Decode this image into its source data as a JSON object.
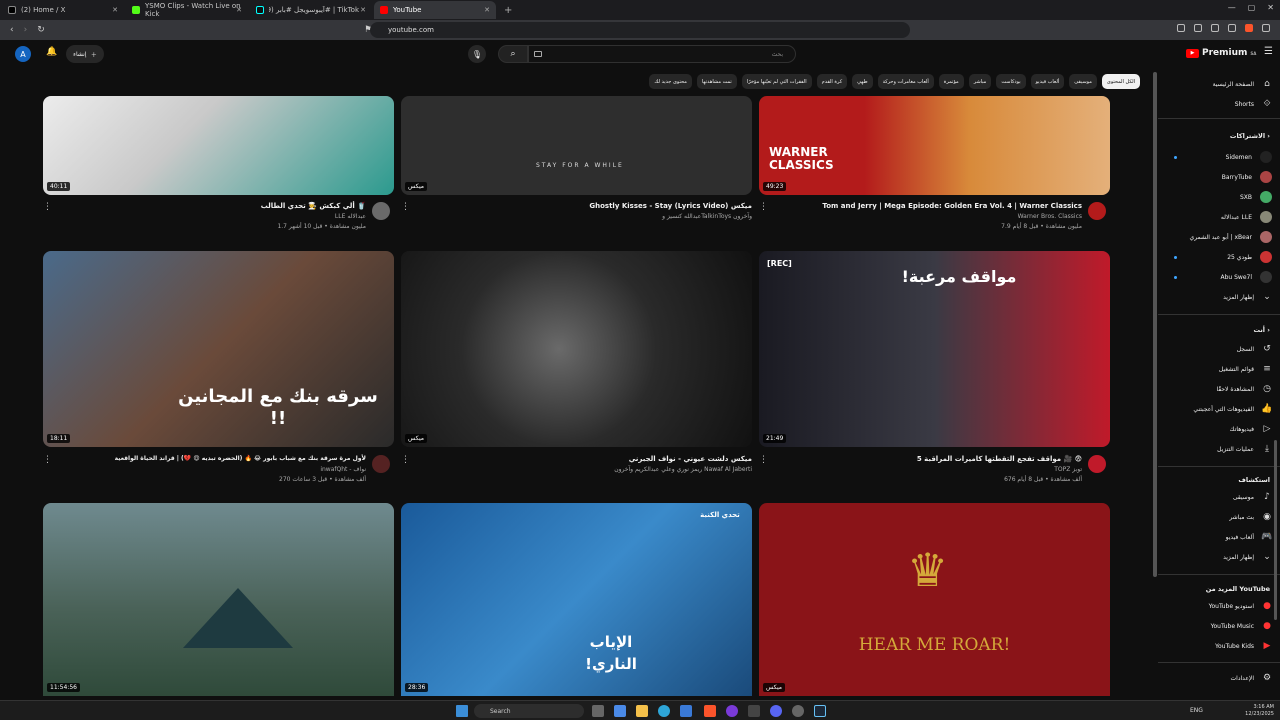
{
  "browser": {
    "tabs": [
      {
        "title": "(2) Home / X",
        "active": false,
        "color": "#000000"
      },
      {
        "title": "YSMO Clips - Watch Live on Kick",
        "active": false,
        "color": "#53fc18"
      },
      {
        "title": "TikTok | #آيبوسويجل #بابر (99+)",
        "active": false,
        "color": "#111111"
      },
      {
        "title": "YouTube",
        "active": true,
        "color": "#ff0000"
      }
    ],
    "new_tab": "+",
    "url": "youtube.com"
  },
  "youtube": {
    "logo_text": "Premium",
    "logo_region": "SA",
    "avatar_letter": "A",
    "create_label": "إنشاء",
    "search_placeholder": "بحث",
    "chips": [
      "الكل المحتوى",
      "موسيقى",
      "ألعاب فيديو",
      "بودكاست",
      "مباشر",
      "مؤتمرة",
      "ألعاب مغامرات وحركة",
      "طهي",
      "كرة القدم",
      "الفقرات التي لم تعيّنها مؤخرًا",
      "تمت مشاهدتها",
      "محتوى جديد لك"
    ]
  },
  "videos": [
    {
      "title": "ألي كبكش 🧑‍🍳 تحدي الطالب 🥤",
      "channel": "LLE عبدالاله",
      "meta": "1.7 مليون مشاهدة • قبل 10 أشهر",
      "duration": "40:11",
      "thumb": "#c83e3e"
    },
    {
      "title": "Ghostly Kisses - Stay (Lyrics Video) ميكس",
      "channel": "عبدالله كنسيز وTalkinToys وآخرون",
      "meta": "",
      "duration": "ميكس",
      "thumb": "#2a2a2a",
      "overlay": "STAY FOR A WHILE"
    },
    {
      "title": "Tom and Jerry | Mega Episode: Golden Era Vol. 4 | Warner Classics",
      "channel": "Warner Bros. Classics",
      "meta": "7.9 مليون مشاهدة • قبل 8 أيام",
      "duration": "49:23",
      "thumb": "#b31b1b",
      "overlay": "WARNER CLASSICS"
    },
    {
      "title": "لأول مرة سرقة بنك مع شباب بابور 😂 🔥 (الحضره تبديه 😍 💔) | قراند الحياة الواقعية",
      "channel": "inwafQht - نواف",
      "meta": "270 ألف مشاهدة • قبل 3 ساعات",
      "duration": "18:11",
      "thumb": "#3a5a7a",
      "overlay": "سرقه بنك مع المجانين !!"
    },
    {
      "title": "ميكس دلشت عيوني - نواف الجبرني",
      "channel": "ريمز نوري وعلي عبدالكريم وآخرون Nawaf Al Jaberti",
      "meta": "",
      "duration": "ميكس",
      "thumb": "#1f1f1f"
    },
    {
      "title": "5 مواقف تفجع التقطتها كاميرات المراقبة 🎥 😨",
      "channel": "TOPZ توبز",
      "meta": "676 ألف مشاهدة • قبل 8 أيام",
      "duration": "21:49",
      "thumb": "#222233",
      "overlay": "مواقف مرعبة!",
      "rec": "[REC]"
    },
    {
      "title": "",
      "channel": "",
      "meta": "",
      "duration": "11:54:56",
      "thumb": "#3a4a4a"
    },
    {
      "title": "",
      "channel": "",
      "meta": "",
      "duration": "28:36",
      "thumb": "#2a6a9a",
      "overlay": "الإياب الناري!",
      "badge": "تحدي الكنبة"
    },
    {
      "title": "",
      "channel": "",
      "meta": "",
      "duration": "ميكس",
      "thumb": "#8a1418",
      "overlay": "HEAR ME ROAR!"
    }
  ],
  "sidebar": {
    "home": "الصفحة الرئيسية",
    "shorts": "Shorts",
    "subs_header": "الاشتراكات",
    "subs": [
      {
        "name": "Sidemen",
        "live": true
      },
      {
        "name": "BarryTube",
        "live": false
      },
      {
        "name": "SXB",
        "live": false
      },
      {
        "name": "عبدالاله LLE",
        "live": false
      },
      {
        "name": "أبو عبد الشمري | xBear",
        "live": false
      },
      {
        "name": "طودي 25",
        "live": true
      },
      {
        "name": "Abu Swe7l",
        "live": true
      }
    ],
    "show_more": "إظهار المزيد",
    "you_header": "أنت",
    "you": [
      "السجل",
      "قوائم التشغيل",
      "المشاهدة لاحقًا",
      "الفيديوهات التي أعجبتني",
      "فيديوهاتك",
      "عمليات التنزيل"
    ],
    "explore_header": "استكشاف",
    "explore": [
      "موسيقى",
      "بث مباشر",
      "ألعاب فيديو",
      "إظهار المزيد"
    ],
    "more_header": "المزيد من YouTube",
    "more": [
      "YouTube استوديو",
      "YouTube Music",
      "YouTube Kids"
    ],
    "settings": "الإعدادات"
  },
  "taskbar": {
    "search": "Search",
    "lang": "ENG",
    "time": "3:16 AM",
    "date": "12/23/2025"
  }
}
